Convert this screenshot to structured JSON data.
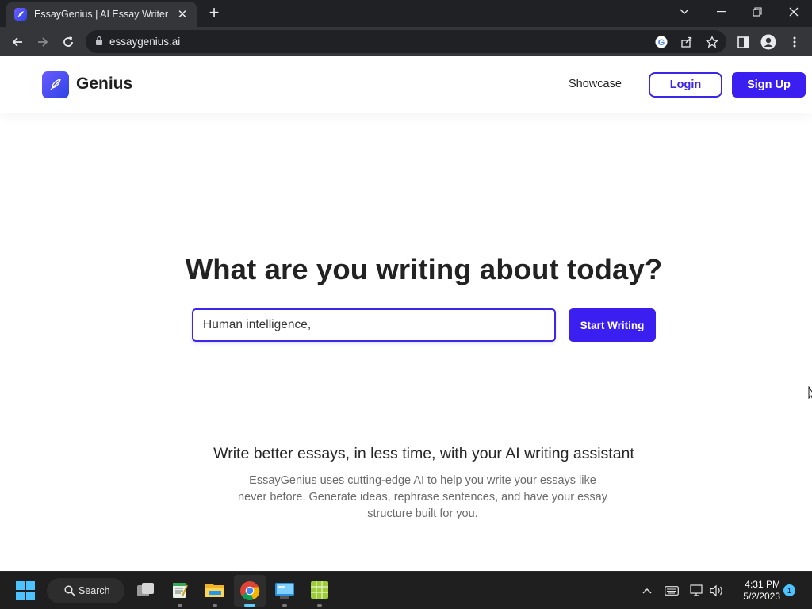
{
  "browser": {
    "tab_title": "EssayGenius | AI Essay Writer",
    "url": "essaygenius.ai"
  },
  "nav": {
    "brand": "Genius",
    "showcase_label": "Showcase",
    "login_label": "Login",
    "signup_label": "Sign Up"
  },
  "hero": {
    "title": "What are you writing about today?",
    "input_value": "Human intelligence,",
    "start_label": "Start Writing"
  },
  "features": {
    "subhead": "Write better essays, in less time, with your AI writing assistant",
    "description": "EssayGenius uses cutting-edge AI to help you write your essays like never before. Generate ideas, rephrase sentences, and have your essay structure built for you."
  },
  "taskbar": {
    "search_label": "Search",
    "time": "4:31 PM",
    "date": "5/2/2023",
    "notification_count": "1",
    "apps": [
      "task-view",
      "notepad",
      "file-explorer",
      "chrome",
      "remote-desktop",
      "spreadsheet"
    ]
  },
  "colors": {
    "accent": "#3b1ff0",
    "chrome_dark": "#202124",
    "chrome_toolbar": "#35363a",
    "taskbar": "#1f1f1f"
  }
}
